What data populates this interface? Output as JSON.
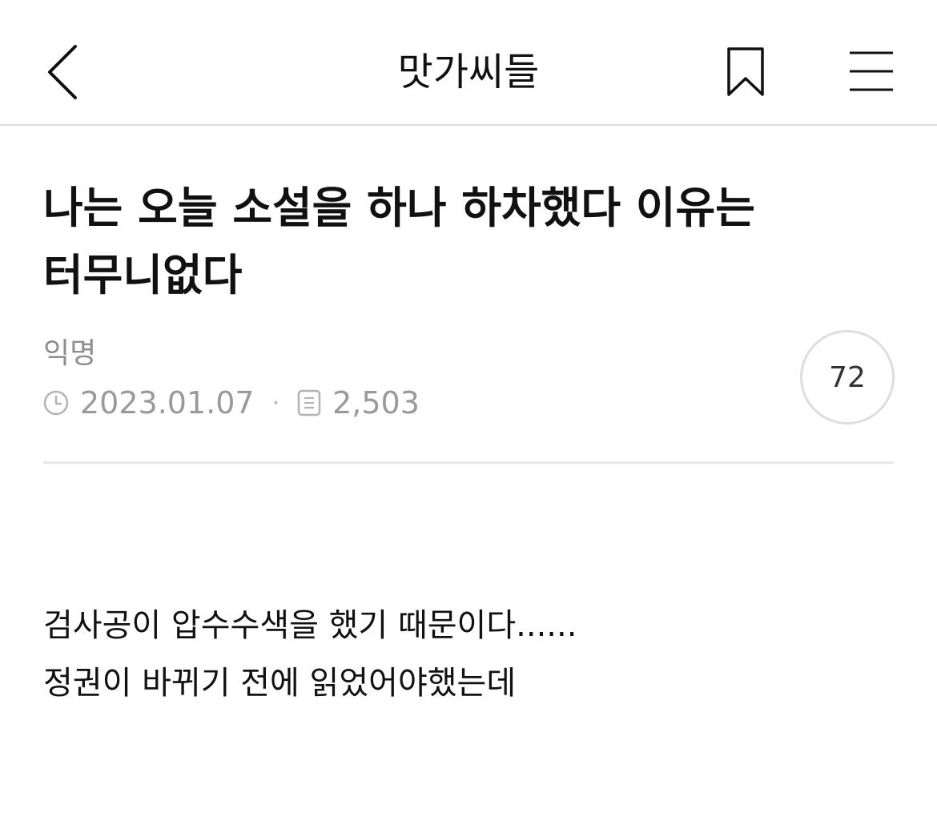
{
  "header": {
    "board_name": "맛가씨들",
    "icons": {
      "back": "chevron-left-icon",
      "bookmark": "bookmark-icon",
      "menu": "hamburger-menu-icon"
    }
  },
  "post": {
    "title": "나는 오늘 소설을 하나 하차했다 이유는 터무니없다",
    "author": "익명",
    "date": "2023.01.07",
    "views": "2,503",
    "comment_count": "72",
    "body_lines": [
      "검사공이 압수수색을 했기 때문이다......",
      "정권이 바뀌기 전에 읽었어야했는데"
    ]
  },
  "colors": {
    "text_primary": "#111111",
    "text_secondary": "#9a9a9a",
    "divider": "#e8e8e8",
    "circle_border": "#dedede"
  }
}
